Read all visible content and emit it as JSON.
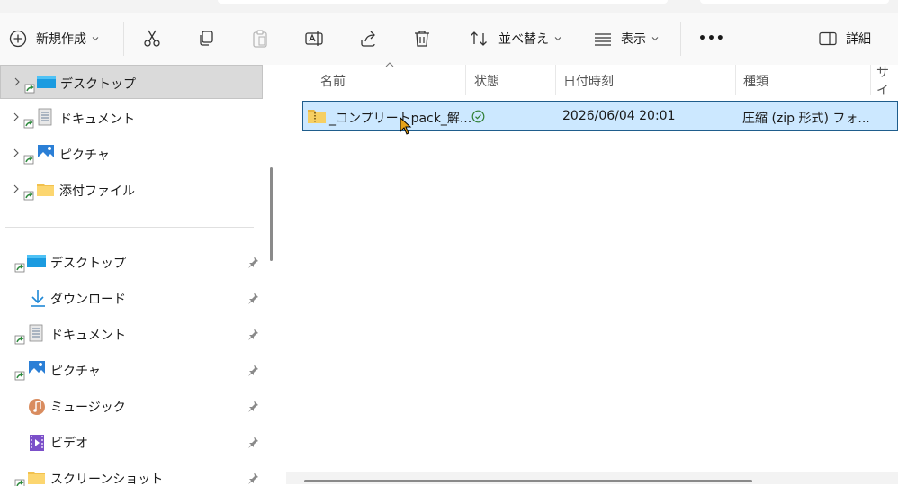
{
  "toolbar": {
    "new_label": "新規作成",
    "sort_label": "並べ替え",
    "view_label": "表示",
    "details_label": "詳細",
    "more_label": "•••"
  },
  "sidebar": {
    "tree_items": [
      {
        "label": "デスクトップ",
        "icon": "desktop-icon",
        "selected": true
      },
      {
        "label": "ドキュメント",
        "icon": "documents-icon",
        "selected": false
      },
      {
        "label": "ピクチャ",
        "icon": "pictures-icon",
        "selected": false
      },
      {
        "label": "添付ファイル",
        "icon": "folder-icon",
        "selected": false
      }
    ],
    "quick_access": [
      {
        "label": "デスクトップ",
        "icon": "desktop-icon"
      },
      {
        "label": "ダウンロード",
        "icon": "download-icon"
      },
      {
        "label": "ドキュメント",
        "icon": "documents-icon"
      },
      {
        "label": "ピクチャ",
        "icon": "pictures-icon"
      },
      {
        "label": "ミュージック",
        "icon": "music-icon"
      },
      {
        "label": "ビデオ",
        "icon": "video-icon"
      },
      {
        "label": "スクリーンショット",
        "icon": "folder-icon"
      }
    ]
  },
  "columns": {
    "name": "名前",
    "status": "状態",
    "date": "日付時刻",
    "type": "種類",
    "size": "サイ"
  },
  "files": [
    {
      "name": "_コンプリートpack_解...",
      "status_icon": "synced-check-icon",
      "date": "2026/06/04 20:01",
      "type": "圧縮 (zip 形式) フォ...",
      "icon": "zip-folder-icon"
    }
  ],
  "colors": {
    "selection_bg": "#cce8ff",
    "selection_border": "#1f5d8c",
    "sidebar_selected": "#dadada",
    "accent": "#0067c0"
  }
}
